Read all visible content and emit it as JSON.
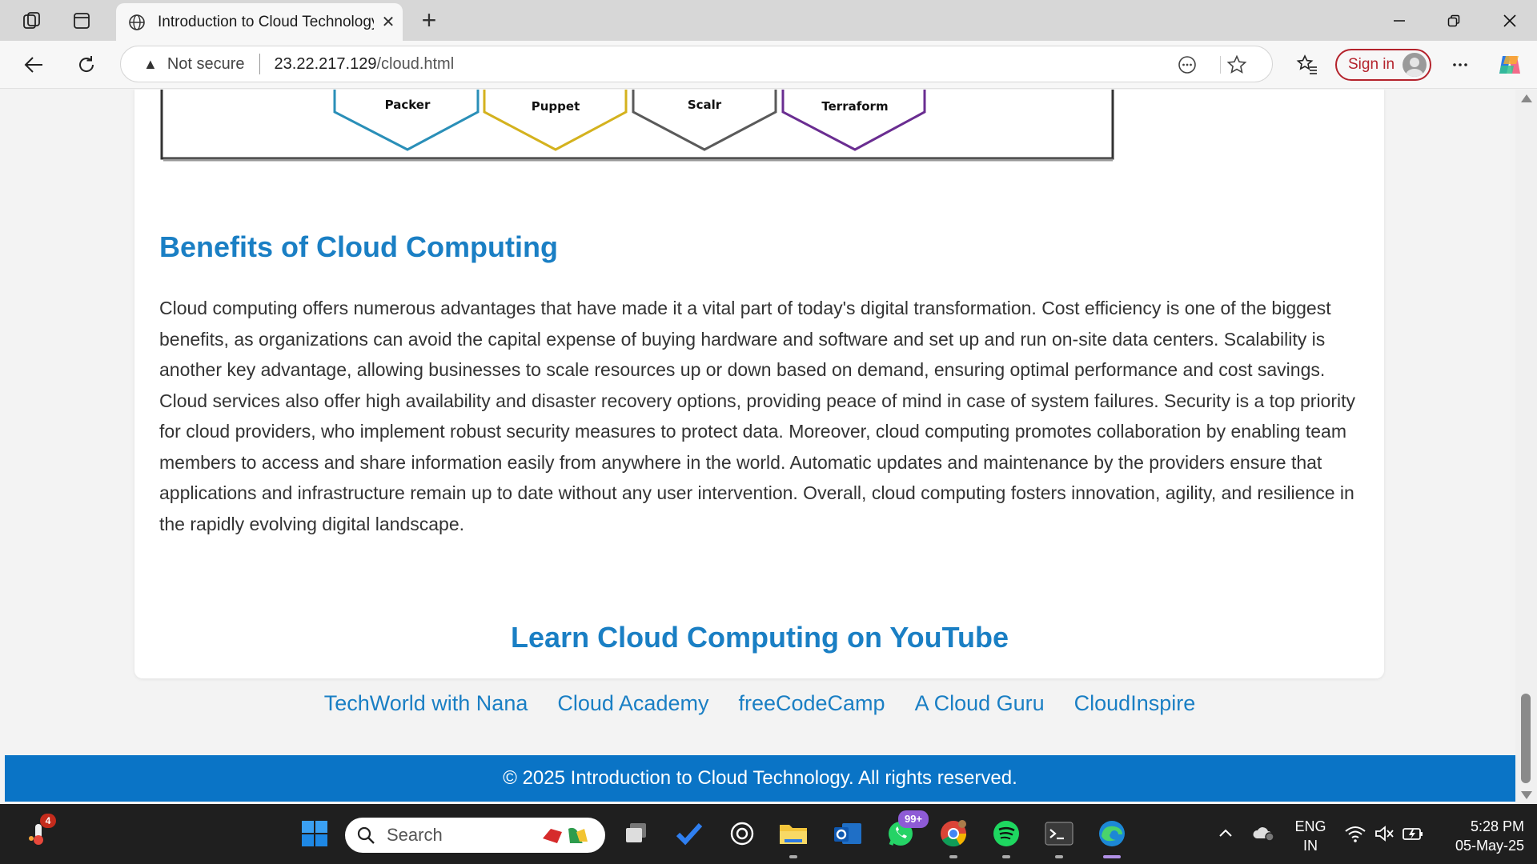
{
  "browser": {
    "tab_title": "Introduction to Cloud Technology",
    "security_label": "Not secure",
    "url_host": "23.22.217.129",
    "url_path": "/cloud.html",
    "sign_in_label": "Sign in"
  },
  "diagram": {
    "labels": [
      "Packer",
      "Puppet",
      "Scalr",
      "Terraform"
    ],
    "colors": [
      "#2a8fb8",
      "#d4b21e",
      "#5a5a5a",
      "#6a2d91"
    ]
  },
  "page": {
    "benefits_title": "Benefits of Cloud Computing",
    "benefits_text": "Cloud computing offers numerous advantages that have made it a vital part of today's digital transformation. Cost efficiency is one of the biggest benefits, as organizations can avoid the capital expense of buying hardware and software and set up and run on-site data centers. Scalability is another key advantage, allowing businesses to scale resources up or down based on demand, ensuring optimal performance and cost savings. Cloud services also offer high availability and disaster recovery options, providing peace of mind in case of system failures. Security is a top priority for cloud providers, who implement robust security measures to protect data. Moreover, cloud computing promotes collaboration by enabling team members to access and share information easily from anywhere in the world. Automatic updates and maintenance by the providers ensure that applications and infrastructure remain up to date without any user intervention. Overall, cloud computing fosters innovation, agility, and resilience in the rapidly evolving digital landscape.",
    "youtube_title": "Learn Cloud Computing on YouTube",
    "youtube_links": [
      "TechWorld with Nana",
      "Cloud Academy",
      "freeCodeCamp",
      "A Cloud Guru",
      "CloudInspire"
    ],
    "footer_text": "© 2025 Introduction to Cloud Technology. All rights reserved.",
    "accent_color": "#1a7fc4",
    "footer_color": "#0a74c6"
  },
  "taskbar": {
    "search_placeholder": "Search",
    "weather_badge": "4",
    "whatsapp_badge": "99+",
    "lang_line1": "ENG",
    "lang_line2": "IN",
    "time": "5:28 PM",
    "date": "05-May-25"
  }
}
